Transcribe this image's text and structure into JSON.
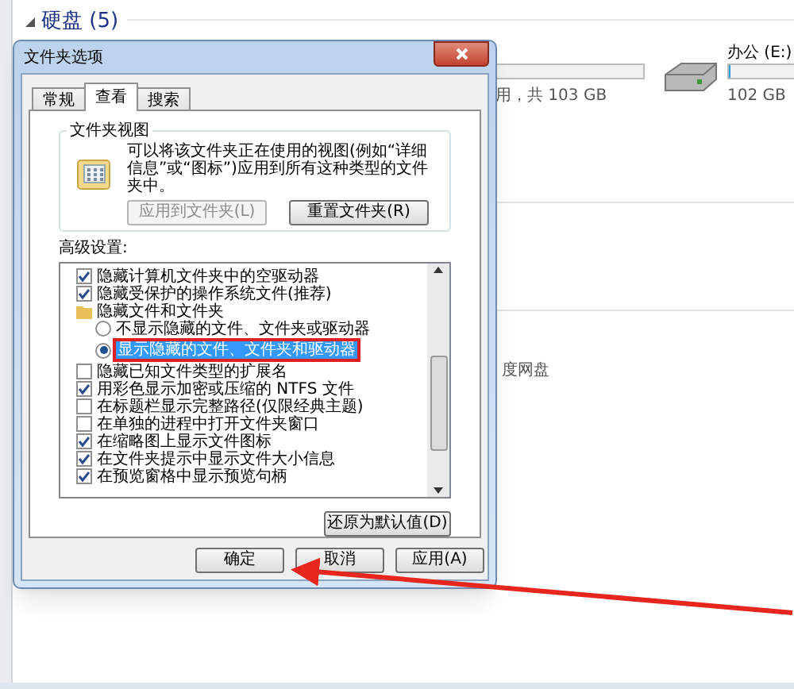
{
  "explorer": {
    "section_header": "硬盘 (5)",
    "drive_usage": "用，共 103 GB",
    "drive": {
      "name": "办公 (E:)",
      "level": 0.02,
      "free": "102 GB"
    },
    "item_label": "度网盘"
  },
  "dialog": {
    "title": "文件夹选项",
    "tabs": [
      {
        "label": "常规",
        "selected": false
      },
      {
        "label": "查看",
        "selected": true
      },
      {
        "label": "搜索",
        "selected": false
      }
    ],
    "folder_views": {
      "title": "文件夹视图",
      "description": "可以将该文件夹正在使用的视图(例如“详细信息”或“图标”)应用到所有这种类型的文件夹中。",
      "buttons": [
        {
          "label": "应用到文件夹(L)",
          "disabled": true
        },
        {
          "label": "重置文件夹(R)",
          "disabled": false
        }
      ]
    },
    "advanced_label": "高级设置:",
    "settings": [
      {
        "kind": "checkbox",
        "label": "隐藏计算机文件夹中的空驱动器",
        "checked": true
      },
      {
        "kind": "checkbox",
        "label": "隐藏受保护的操作系统文件(推荐)",
        "checked": true
      },
      {
        "kind": "folder",
        "label": "隐藏文件和文件夹",
        "children": [
          {
            "kind": "radio",
            "label": "不显示隐藏的文件、文件夹或驱动器",
            "selected": false
          },
          {
            "kind": "radio",
            "label": "显示隐藏的文件、文件夹和驱动器",
            "selected": true
          }
        ]
      },
      {
        "kind": "checkbox",
        "label": "隐藏已知文件类型的扩展名",
        "checked": false
      },
      {
        "kind": "checkbox",
        "label": "用彩色显示加密或压缩的 NTFS 文件",
        "checked": true
      },
      {
        "kind": "checkbox",
        "label": "在标题栏显示完整路径(仅限经典主题)",
        "checked": false
      },
      {
        "kind": "checkbox",
        "label": "在单独的进程中打开文件夹窗口",
        "checked": false
      },
      {
        "kind": "checkbox",
        "label": "在缩略图上显示文件图标",
        "checked": true
      },
      {
        "kind": "checkbox",
        "label": "在文件夹提示中显示文件大小信息",
        "checked": true
      },
      {
        "kind": "checkbox",
        "label": "在预览窗格中显示预览句柄",
        "checked": true
      }
    ],
    "restore_button": "还原为默认值(D)",
    "buttons": [
      "确定",
      "取消",
      "应用(A)"
    ]
  }
}
